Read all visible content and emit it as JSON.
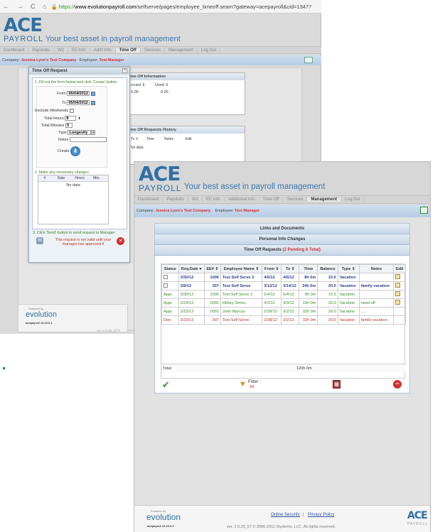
{
  "browser": {
    "nav": "← → C ⌂",
    "url_scheme": "https://",
    "url_domain": "www.evolutionpayroll.com",
    "url_path": "/selfserve/pages/employee_timeoff.seam?gateway=acepayroll&cid=13477"
  },
  "brand": {
    "ace": "ACE",
    "payroll": "PAYROLL",
    "tagline": "Your best asset in payroll management"
  },
  "back_menu": [
    "Dashboard",
    "Paystubs",
    "W2",
    "EE Info",
    "Add'l Info",
    "Time Off",
    "Services",
    "Management",
    "Log Out"
  ],
  "back_active": "Time Off",
  "company": {
    "label": "Company:",
    "value": "Jessica Lynn's Test Company",
    "emp_label": "Employee:",
    "emp_value": "Test Manager"
  },
  "back_panels": {
    "info_title": "Time Off Information",
    "info_cols": [
      "Accrued ⇕",
      "Used ⇕"
    ],
    "info_vals": [
      "0.00",
      "0.00"
    ],
    "hist_title": "Time Off Requests History",
    "hist_cols": [
      "To ⇕",
      "Time",
      "Notes",
      "Edit"
    ],
    "hist_empty": "No data"
  },
  "dialog": {
    "title": "Time Off Request",
    "step1": "1. Fill out the form below and click 'Create' button",
    "from_label": "From",
    "from_val": "05/04/2012",
    "to_label": "To",
    "to_val": "05/04/2012",
    "exclude_label": "Exclude Weekends",
    "hours_label": "Total Hours",
    "hours_val": "8",
    "minutes_label": "Total Minutes",
    "minutes_val": "0",
    "type_label": "Type",
    "type_val": "Longevity",
    "notes_label": "Notes",
    "create_label": "Create",
    "step2": "2. Make any necessary changes",
    "grid_cols": [
      "#",
      "Date",
      "Hours",
      "Min."
    ],
    "grid_empty": "No data",
    "step3": "3. Click 'Send' button to send request to Manager",
    "warning": "This request is not valid until your manager has approved it"
  },
  "footer_back": {
    "powered": "Powered by",
    "evolution": "evolution",
    "version_tag": "acepayroll 13.23.0.1",
    "ver": "ver. 2.0.20_57 ©"
  },
  "front_menu": [
    "Dashboard",
    "Paystubs",
    "W2",
    "EE Info",
    "Additional Info",
    "Time Off",
    "Services",
    "Management",
    "Log Out"
  ],
  "front_active": "Management",
  "sections": {
    "links": "Links and Documents",
    "personal": "Personal Info Changes",
    "timeoff": "Time Off Requests",
    "timeoff_pending": "(2 Pending 6 Total)"
  },
  "table": {
    "cols": [
      "Status",
      "Req.Date ▾",
      "EE# ⇕",
      "Employee Name ⇕",
      "From ⇕",
      "To ⇕",
      "Time",
      "Balance",
      "Type ⇕",
      "Notes",
      "Edit"
    ],
    "rows": [
      {
        "status": "",
        "req": "3/30/12",
        "ee": "1006",
        "name": "Test Self Serve 2",
        "from": "4/6/12",
        "to": "4/6/12",
        "time": "8h 0m",
        "bal": "10.0",
        "type": "Vacation",
        "notes": "",
        "cls": "blue"
      },
      {
        "status": "",
        "req": "3/9/12",
        "ee": "307",
        "name": "Test Self Serve",
        "from": "3/12/12",
        "to": "3/14/12",
        "time": "24h 0m",
        "bal": "20.0",
        "type": "Vacation",
        "notes": "family vacation",
        "cls": "blue"
      },
      {
        "status": "Appr.",
        "req": "3/30/12",
        "ee": "1006",
        "name": "Test Self Serve 2",
        "from": "6/4/12",
        "to": "6/4/12",
        "time": "8h 0m",
        "bal": "10.0",
        "type": "Vacation",
        "notes": "",
        "cls": "green"
      },
      {
        "status": "Appr.",
        "req": "2/24/12",
        "ee": "0002",
        "name": "Hillary Simon",
        "from": "4/2/12",
        "to": "4/3/12",
        "time": "16h 0m",
        "bal": "20.0",
        "type": "Vacation",
        "notes": "need off",
        "cls": "green"
      },
      {
        "status": "Appr.",
        "req": "2/23/12",
        "ee": "0001",
        "name": "John Marcus",
        "from": "2/28/12",
        "to": "3/2/12",
        "time": "32h 0m",
        "bal": "20.0",
        "type": "Vacation",
        "notes": "....",
        "cls": "green"
      },
      {
        "status": "Den.",
        "req": "2/23/12",
        "ee": "307",
        "name": "Test Self Serve",
        "from": "2/28/12",
        "to": "3/2/12",
        "time": "32h 0m",
        "bal": "20.0",
        "type": "Vacation",
        "notes": "family vacation",
        "cls": "red"
      }
    ],
    "total_label": "Total",
    "total_time": "120h 0m",
    "filter_label": "Filter :",
    "filter_val": "All"
  },
  "footer_front": {
    "powered": "Powered by",
    "evolution": "evolution",
    "version_tag": "acepayroll 13.23.0.1",
    "security": "Online Security",
    "sep": "|",
    "privacy": "Privacy Policy",
    "ver": "ver. 2.0.20_57 © 2006-2011 iSystems, LLC. All rights reserved.",
    "ace": "ACE",
    "payroll": "PAYROLL"
  },
  "colors": {
    "brand": "#2f6fa3",
    "approved": "#3a8a2a",
    "denied": "#c03020",
    "pending": "#2a3f8f"
  }
}
